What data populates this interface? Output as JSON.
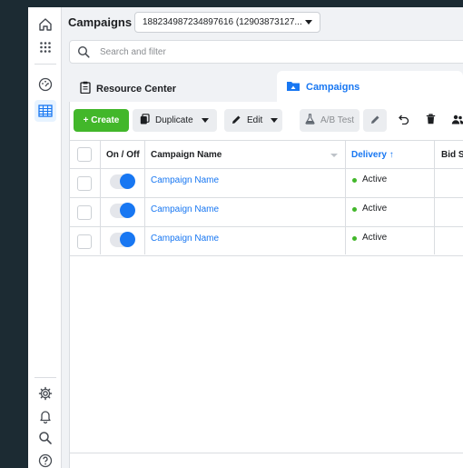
{
  "header": {
    "title": "Campaigns",
    "account_selector": "188234987234897616 (12903873127..."
  },
  "search": {
    "placeholder": "Search and filter"
  },
  "tabs": [
    {
      "label": "Resource Center"
    },
    {
      "label": "Campaigns"
    }
  ],
  "toolbar": {
    "create_label": "+ Create",
    "duplicate_label": "Duplicate",
    "edit_label": "Edit",
    "ab_test_label": "A/B Test"
  },
  "table": {
    "columns": [
      "On / Off",
      "Campaign Name",
      "Delivery ↑",
      "Bid St"
    ],
    "rows": [
      {
        "campaign_name": "Campaign Name",
        "delivery": "Active",
        "on": true
      },
      {
        "campaign_name": "Campaign Name",
        "delivery": "Active",
        "on": true
      },
      {
        "campaign_name": "Campaign Name",
        "delivery": "Active",
        "on": true
      }
    ]
  },
  "colors": {
    "accent_blue": "#1877f2",
    "create_green": "#42b72a",
    "active_dot": "#42b72a",
    "frame_bg": "#1c2b33"
  },
  "rail_icons": [
    "home-icon",
    "apps-grid-icon",
    "dashboard-gauge-icon",
    "campaign-table-icon",
    "settings-gear-icon",
    "notifications-bell-icon",
    "search-icon",
    "help-icon"
  ]
}
